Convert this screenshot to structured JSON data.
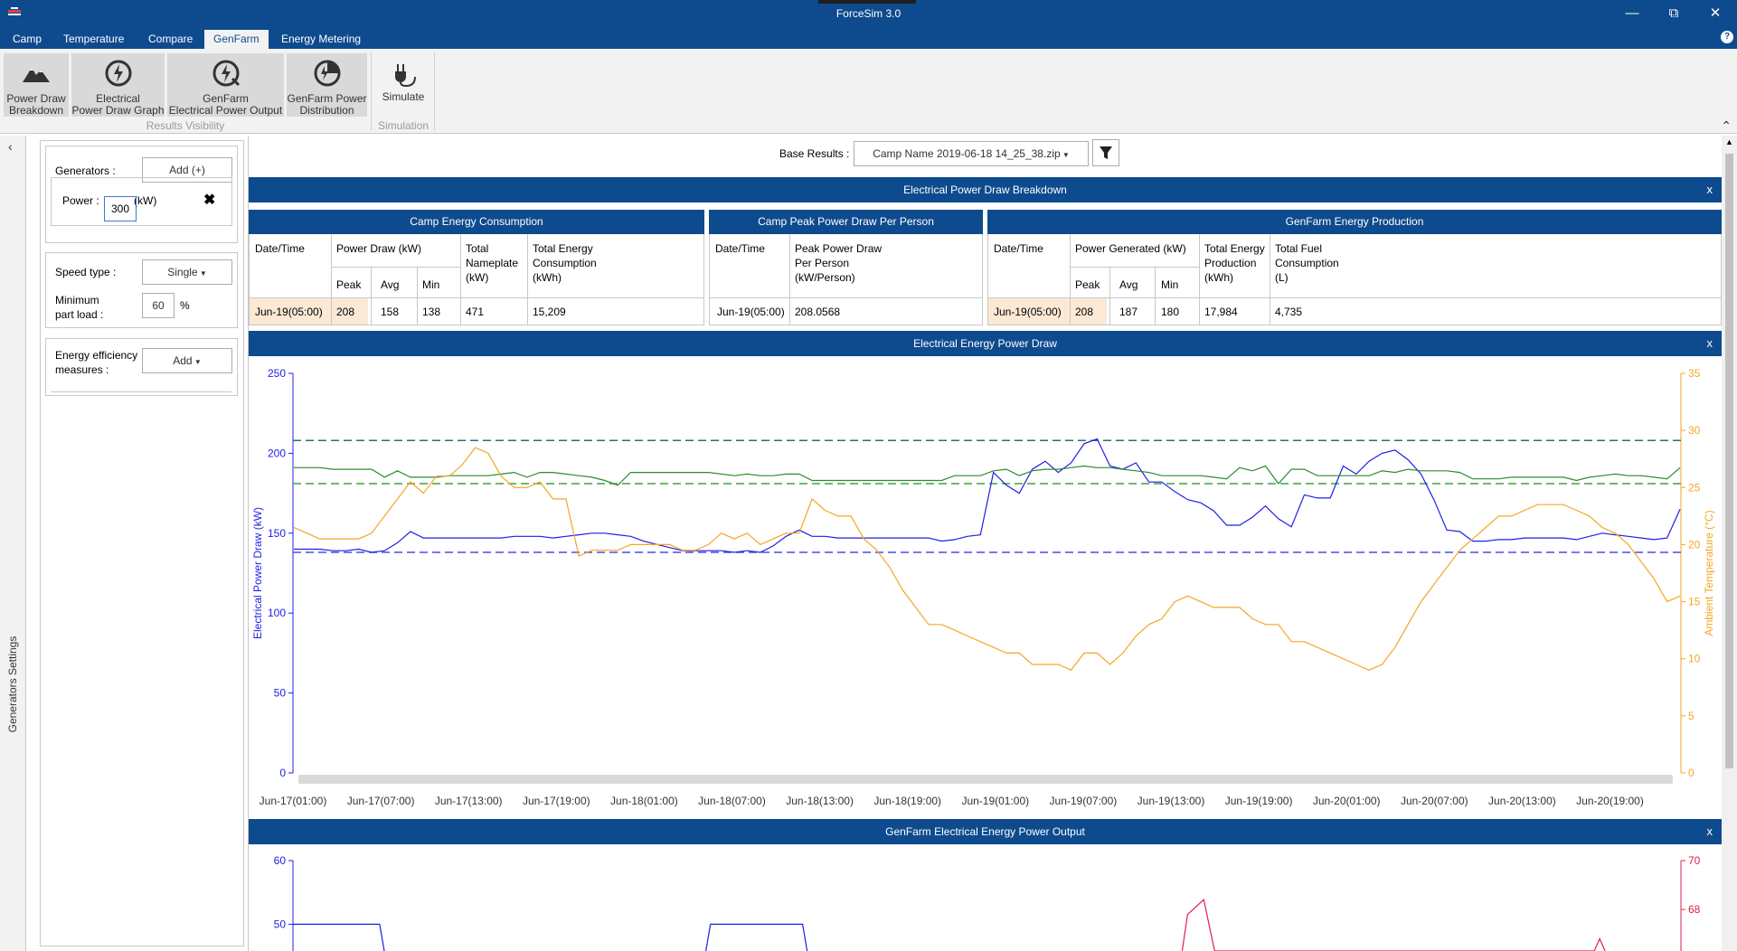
{
  "window": {
    "title": "ForceSim 3.0"
  },
  "tabs": [
    {
      "label": "Camp"
    },
    {
      "label": "Temperature"
    },
    {
      "label": "Compare"
    },
    {
      "label": "GenFarm"
    },
    {
      "label": "Energy Metering"
    }
  ],
  "ribbon": {
    "buttons": [
      {
        "line1": "Power Draw",
        "line2": "Breakdown"
      },
      {
        "line1": "Electrical",
        "line2": "Power Draw Graph"
      },
      {
        "line1": "GenFarm",
        "line2": "Electrical Power Output"
      },
      {
        "line1": "GenFarm Power",
        "line2": "Distribution"
      }
    ],
    "results_group": "Results Visibility",
    "simulate_label": "Simulate",
    "simulation_group": "Simulation"
  },
  "left_strip": {
    "label": "Generators Settings"
  },
  "settings": {
    "generators_label": "Generators :",
    "add_button": "Add (+)",
    "power_label": "Power :",
    "power_value": "300",
    "power_unit": "(kW)",
    "speed_type_label": "Speed type :",
    "speed_type_value": "Single",
    "min_part_load_label_1": "Minimum",
    "min_part_load_label_2": "part load :",
    "min_part_load_value": "60",
    "min_part_load_unit": "%",
    "eem_label_1": "Energy efficiency",
    "eem_label_2": "measures :",
    "eem_add": "Add"
  },
  "base_results": {
    "label": "Base Results :",
    "value": "Camp Name 2019-06-18 14_25_38.zip"
  },
  "breakdown": {
    "title": "Electrical Power Draw Breakdown",
    "close": "x",
    "camp": {
      "title": "Camp Energy Consumption",
      "h_datetime": "Date/Time",
      "h_power_draw": "Power Draw (kW)",
      "h_total_nameplate": [
        "Total",
        "Nameplate",
        "(kW)"
      ],
      "h_total_energy": [
        "Total Energy",
        "Consumption",
        "(kWh)"
      ],
      "h_peak": "Peak",
      "h_avg": "Avg",
      "h_min": "Min",
      "row": {
        "datetime": "Jun-19(05:00)",
        "peak": "208",
        "avg": "158",
        "min": "138",
        "nameplate": "471",
        "energy": "15,209"
      }
    },
    "peak_per_person": {
      "title": "Camp Peak Power Draw Per Person",
      "h_datetime": "Date/Time",
      "h_value": [
        "Peak Power Draw",
        "Per Person",
        "(kW/Person)"
      ],
      "row": {
        "datetime": "Jun-19(05:00)",
        "value": "208.0568"
      }
    },
    "genfarm": {
      "title": "GenFarm Energy Production",
      "h_datetime": "Date/Time",
      "h_power_generated": "Power Generated (kW)",
      "h_total_energy": [
        "Total Energy",
        "Production",
        "(kWh)"
      ],
      "h_total_fuel": [
        "Total Fuel",
        "Consumption",
        "(L)"
      ],
      "h_peak": "Peak",
      "h_avg": "Avg",
      "h_min": "Min",
      "row": {
        "datetime": "Jun-19(05:00)",
        "peak": "208",
        "avg": "187",
        "min": "180",
        "energy": "17,984",
        "fuel": "4,735"
      }
    }
  },
  "power_draw_chart_title": "Electrical Energy Power Draw",
  "genfarm_output_title": "GenFarm Electrical Energy Power Output",
  "colors": {
    "header_blue": "#0e4b8e",
    "power_draw": "#1f1fe6",
    "temperature": "#f5a623",
    "nameplate_green": "#2e8b2e",
    "output_red": "#e0204a"
  },
  "chart_data": [
    {
      "type": "line",
      "title": "Electrical Energy Power Draw",
      "ylabel": "Electrical Power Draw (kW)",
      "y2label": "Ambient Temperature (°C)",
      "ylim": [
        0,
        250
      ],
      "y2lim": [
        0,
        35
      ],
      "yticks": [
        0,
        50,
        100,
        150,
        200,
        250
      ],
      "y2ticks": [
        0,
        5,
        10,
        15,
        20,
        25,
        30,
        35
      ],
      "xticks": [
        "Jun-17(01:00)",
        "Jun-17(07:00)",
        "Jun-17(13:00)",
        "Jun-17(19:00)",
        "Jun-18(01:00)",
        "Jun-18(07:00)",
        "Jun-18(13:00)",
        "Jun-18(19:00)",
        "Jun-19(01:00)",
        "Jun-19(07:00)",
        "Jun-19(13:00)",
        "Jun-19(19:00)",
        "Jun-20(01:00)",
        "Jun-20(07:00)",
        "Jun-20(13:00)",
        "Jun-20(19:00)"
      ],
      "x_start_hour": 0,
      "x_end_hour": 95,
      "reference_lines": [
        {
          "axis": "y",
          "value": 208,
          "color": "#2f6e6a"
        },
        {
          "axis": "y",
          "value": 181,
          "color": "#3aa63a"
        },
        {
          "axis": "y",
          "value": 138,
          "color": "#4a4af0"
        }
      ],
      "series": [
        {
          "axis": "y",
          "color": "#1f1fe6",
          "values": [
            140,
            140,
            140,
            139,
            139,
            140,
            138,
            139,
            144,
            151,
            147,
            147,
            147,
            147,
            147,
            147,
            147,
            148,
            148,
            148,
            147,
            148,
            149,
            150,
            150,
            149,
            148,
            145,
            143,
            141,
            139,
            139,
            139,
            139,
            138,
            139,
            138,
            142,
            148,
            152,
            148,
            148,
            147,
            147,
            147,
            147,
            147,
            147,
            147,
            147,
            145,
            146,
            148,
            149,
            188,
            180,
            175,
            190,
            195,
            188,
            194,
            206,
            209,
            192,
            190,
            194,
            182,
            182,
            176,
            171,
            169,
            164,
            155,
            155,
            160,
            167,
            159,
            154,
            174,
            172,
            172,
            192,
            187,
            195,
            200,
            202,
            196,
            187,
            171,
            152,
            151,
            145,
            145,
            146,
            146,
            147,
            147,
            147,
            147,
            146,
            148,
            150,
            149,
            148,
            147,
            146,
            147,
            165
          ]
        },
        {
          "axis": "y",
          "color": "#2e8b2e",
          "values": [
            191,
            191,
            191,
            190,
            190,
            190,
            190,
            185,
            189,
            185,
            185,
            185,
            186,
            186,
            186,
            186,
            187,
            188,
            185,
            188,
            188,
            187,
            186,
            185,
            183,
            180,
            188,
            188,
            188,
            188,
            188,
            188,
            188,
            187,
            186,
            187,
            186,
            186,
            187,
            187,
            183,
            183,
            183,
            183,
            183,
            183,
            183,
            183,
            183,
            183,
            183,
            186,
            186,
            186,
            189,
            190,
            186,
            189,
            190,
            190,
            191,
            192,
            191,
            191,
            190,
            189,
            188,
            186,
            186,
            186,
            186,
            185,
            184,
            191,
            189,
            192,
            181,
            190,
            190,
            186,
            186,
            186,
            186,
            186,
            189,
            188,
            190,
            189,
            189,
            189,
            188,
            184,
            184,
            184,
            185,
            185,
            185,
            185,
            185,
            183,
            185,
            186,
            187,
            186,
            186,
            185,
            184,
            191
          ]
        },
        {
          "axis": "y2",
          "color": "#f5a623",
          "values": [
            21.5,
            21,
            20.5,
            20.5,
            20.5,
            20.5,
            21,
            22.5,
            24,
            25.5,
            24.5,
            26,
            26,
            27,
            28.5,
            28,
            26,
            25,
            25,
            25.5,
            24,
            24,
            19,
            19.5,
            19.5,
            19.5,
            20,
            20,
            20,
            20,
            19.5,
            19.5,
            20,
            21,
            20.5,
            21,
            20,
            20.5,
            21,
            21,
            24,
            23,
            22.5,
            22.5,
            20.5,
            19.5,
            18,
            16,
            14.5,
            13,
            13,
            12.5,
            12,
            11.5,
            11,
            10.5,
            10.5,
            9.5,
            9.5,
            9.5,
            9,
            10.5,
            10.5,
            9.5,
            10.5,
            12,
            13,
            13.5,
            15,
            15.5,
            15,
            14.5,
            14.5,
            14.5,
            13.5,
            13,
            13,
            11.5,
            11.5,
            11,
            10.5,
            10,
            9.5,
            9,
            9.5,
            11,
            13,
            15,
            16.5,
            18,
            19.5,
            20.5,
            21.5,
            22.5,
            22.5,
            23,
            23.5,
            23.5,
            23.5,
            23,
            22.5,
            21.5,
            21,
            20,
            18.5,
            17,
            15,
            15.5
          ]
        }
      ]
    },
    {
      "type": "line",
      "title": "GenFarm Electrical Energy Power Output",
      "yticks": [
        50,
        60
      ],
      "y2ticks": [
        68,
        70
      ],
      "visible_ylim": [
        45.8,
        60
      ],
      "visible_y2lim": [
        66.3,
        70
      ],
      "series": [
        {
          "axis": "y",
          "color": "#1f1fe6",
          "points": [
            [
              0,
              50
            ],
            [
              8,
              50
            ],
            [
              8.5,
              45
            ],
            [
              38,
              45
            ],
            [
              38.5,
              50
            ],
            [
              47,
              50
            ],
            [
              47.5,
              45
            ]
          ]
        },
        {
          "axis": "y2",
          "color": "#e0204a",
          "points": [
            [
              82,
              66.3
            ],
            [
              82.5,
              67.8
            ],
            [
              84,
              68.4
            ],
            [
              85,
              66.3
            ],
            [
              120,
              66.3
            ],
            [
              120.5,
              66.8
            ],
            [
              121,
              66.3
            ]
          ]
        }
      ]
    }
  ]
}
